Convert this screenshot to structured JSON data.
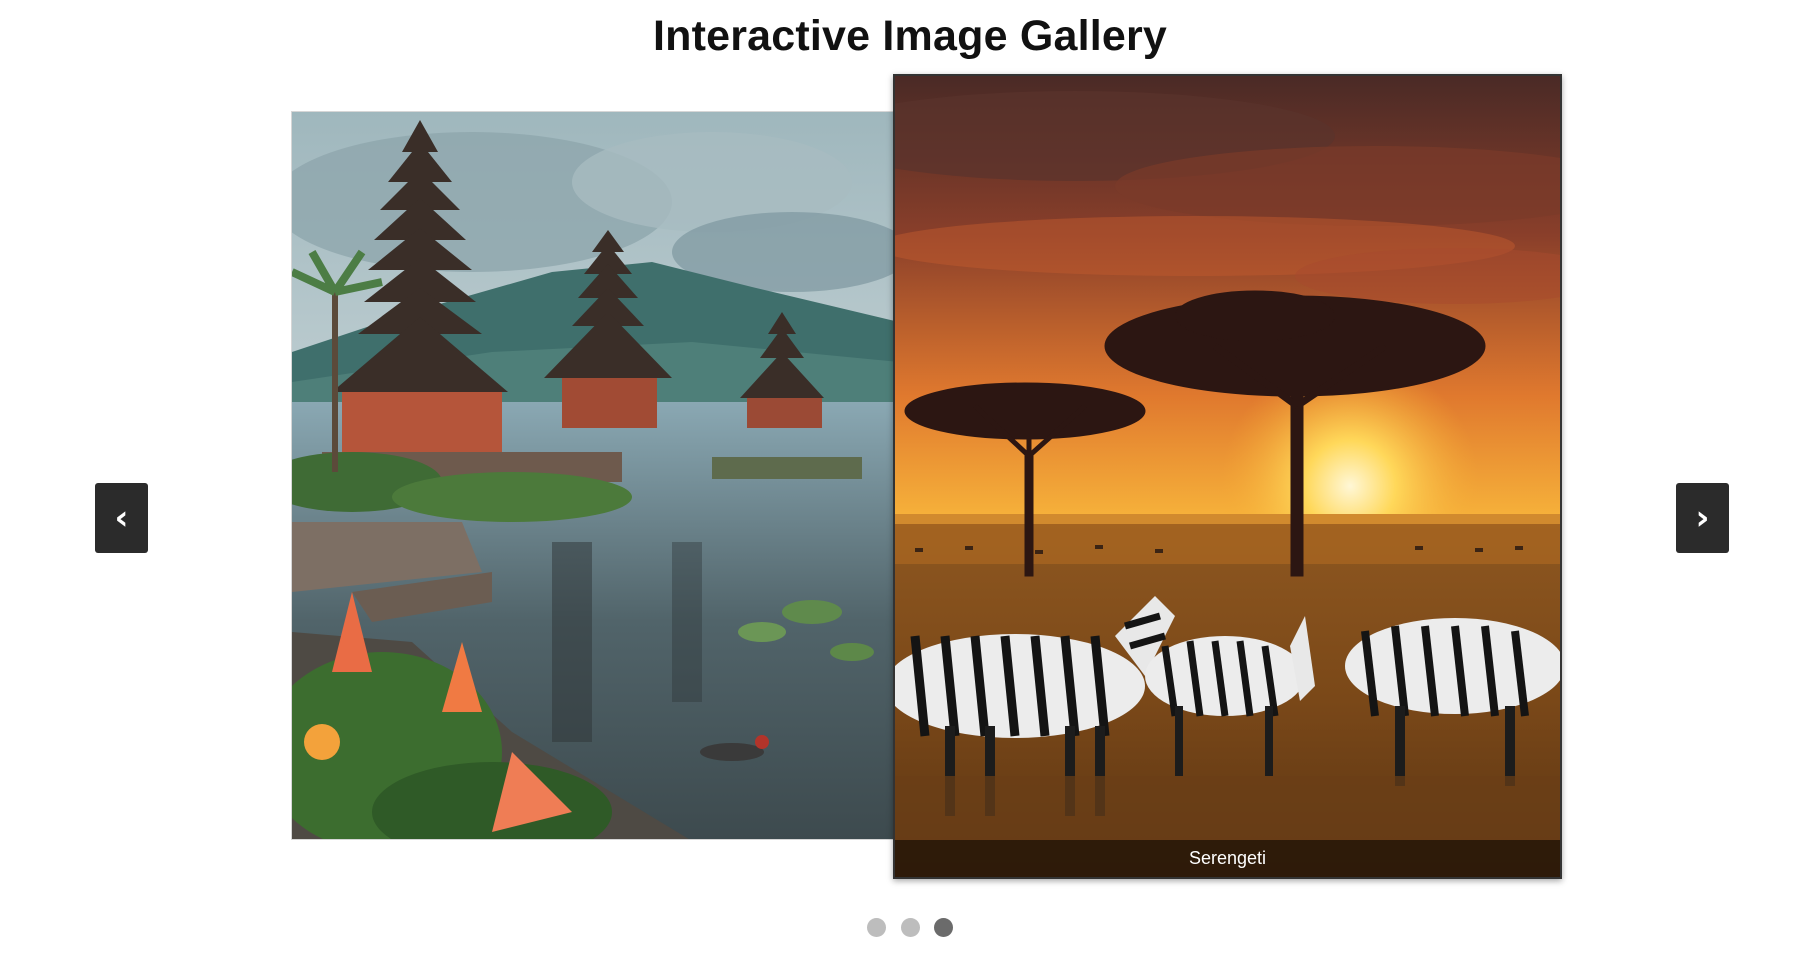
{
  "gallery": {
    "title": "Interactive Image Gallery"
  },
  "slides": [
    {
      "image": "bali-lake-temple-photo",
      "caption": ""
    },
    {
      "image": "serengeti-sunset-zebras-photo",
      "caption": "Serengeti"
    }
  ],
  "nav": {
    "prev_label": "‹",
    "next_label": "›"
  },
  "pagination": {
    "count": 3,
    "active_index": 2
  },
  "colors": {
    "nav_button_bg": "#2b2b2b",
    "dot_inactive": "#bdbdbd",
    "dot_active": "#6b6b6b"
  }
}
